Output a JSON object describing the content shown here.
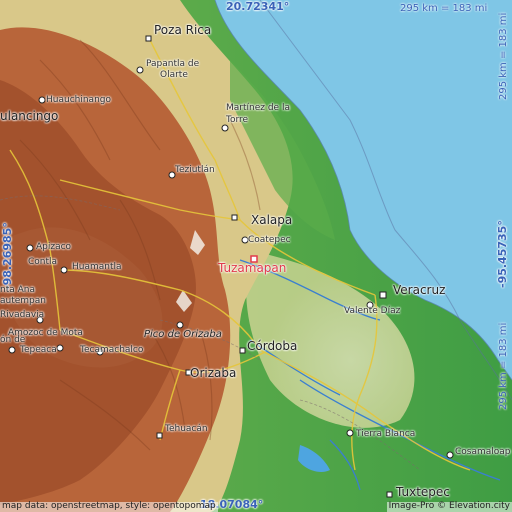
{
  "map": {
    "target": "Tuzamapan",
    "coordinates": {
      "top_lat": "20.72341°",
      "bottom_lat": "18.07084°",
      "left_lon": "-98.26985°",
      "right_lon": "-95.45735°",
      "left_lon_partial": "-98.26985°"
    },
    "scale": {
      "top": "295 km = 183 mi",
      "right_top": "295 km = 183 mi",
      "right_bottom": "295 km = 183 mi"
    },
    "attribution_left": "map data: openstreetmap, style: opentopomap",
    "attribution_right": "Image-Pro © Elevation.city",
    "cities": {
      "poza_rica": "Poza Rica",
      "papantla": "Papantla de",
      "papantla2": "Olarte",
      "huauchinango": "Huauchinango",
      "tulancingo": "ulancingo",
      "martinez": "Martínez de la",
      "martinez2": "Torre",
      "teziutlan": "Teziutlán",
      "xalapa": "Xalapa",
      "coatepec": "Coatepec",
      "tuzamapan": "Tuzamapan",
      "veracruz": "Veracruz",
      "valente": "Valente Díaz",
      "apizaco": "Apizaco",
      "contla": "Contla",
      "huamantla": "Huamantla",
      "santa_ana": "nta Ana",
      "cuautempan": "autempan",
      "rivadavia": "Rivadavia",
      "amozoc": "Amozoc de Mota",
      "pico": "Pico de Orizaba",
      "cordoba": "Córdoba",
      "tepeaca": "Tepeaca",
      "tecamachalco": "Tecamachalco",
      "orizaba": "Orizaba",
      "tehuacan": "Tehuacán",
      "tierra_blanca": "Tierra Blanca",
      "cosamaloapan": "Cosamaloap",
      "tuxtepec": "Tuxtepec",
      "cholula": "ón de"
    },
    "colors": {
      "sea": "#7fc6e6",
      "lowland": "#4fa84a",
      "mid": "#e6dd9a",
      "highland": "#b8653a",
      "coord_blue": "#3a63b8",
      "target_red": "#e23a4c"
    }
  }
}
